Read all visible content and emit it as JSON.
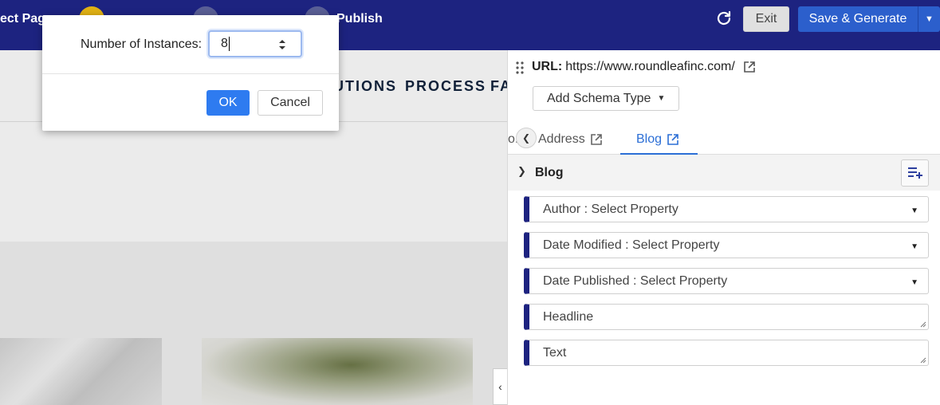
{
  "topbar": {
    "step_prev_label": "ect Pag",
    "step_publish_label": "Publish",
    "refresh_icon": "refresh-icon",
    "exit_label": "Exit",
    "save_label": "Save & Generate",
    "save_caret_icon": "caret-down-icon",
    "background": "#1d2380"
  },
  "site": {
    "nav": [
      "UTIONS",
      "PROCESS",
      "FA"
    ]
  },
  "panel": {
    "url_label": "URL:",
    "url_value": "https://www.roundleafinc.com/",
    "add_schema_label": "Add Schema Type",
    "tabs": [
      {
        "label": "Address"
      },
      {
        "label": "Blog",
        "active": true
      }
    ],
    "tab_cut_label": "o.",
    "section_title": "Blog",
    "fields": [
      {
        "label": "Author : Select Property",
        "kind": "select"
      },
      {
        "label": "Date Modified : Select Property",
        "kind": "select"
      },
      {
        "label": "Date Published : Select Property",
        "kind": "select"
      },
      {
        "label": "Headline",
        "kind": "textarea"
      },
      {
        "label": "Text",
        "kind": "textarea"
      }
    ],
    "accent": "#1d2380",
    "tab_active_color": "#2c6fd6"
  },
  "modal": {
    "label": "Number of Instances:",
    "value": "8",
    "ok_label": "OK",
    "cancel_label": "Cancel",
    "ok_color": "#2e7bf0"
  }
}
